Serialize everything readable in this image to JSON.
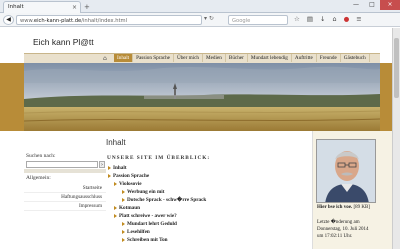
{
  "browser": {
    "tab_title": "Inhalt",
    "tab_close": "×",
    "new_tab": "+",
    "window_buttons": [
      "—",
      "□",
      "×"
    ],
    "url_prefix": "www.",
    "url_host": "eich-kann-platt.de",
    "url_path": "/inhalt/index.html",
    "search_placeholder": "Google",
    "toolbar_icons": [
      "star-icon",
      "clipboard-icon",
      "download-icon",
      "home-icon",
      "adblock-icon",
      "menu-icon"
    ]
  },
  "site": {
    "title": "Eich kann Pl@tt",
    "menu": [
      "Inhalt",
      "Passion Sprache",
      "Über mich",
      "Medien",
      "Bücher",
      "Mundart lebendig",
      "Auftritte",
      "Freunde",
      "Gästebuch"
    ],
    "active_menu": "Inhalt"
  },
  "sidebar": {
    "search_label": "Suchen nach:",
    "search_value": "",
    "section_title": "Allgemein:",
    "links": [
      "Startseite",
      "Haftungsausschluss",
      "Impressum"
    ]
  },
  "content": {
    "heading": "Inhalt",
    "overview": "UNSERE SITE IM ÜBERBLICK:",
    "toc": [
      {
        "level": 1,
        "text": "Inhalt"
      },
      {
        "level": 1,
        "text": "Passion Sprache"
      },
      {
        "level": 2,
        "text": "Violosovie"
      },
      {
        "level": 3,
        "text": "Werbung ein mit"
      },
      {
        "level": 3,
        "text": "Dotsche Sprack - schw�rre Sprack"
      },
      {
        "level": 2,
        "text": "Kotmaun"
      },
      {
        "level": 2,
        "text": "Platt schreiwe - awer wie?"
      },
      {
        "level": 3,
        "text": "Mundart lehrt Geduld"
      },
      {
        "level": 3,
        "text": "Lesehilfen"
      },
      {
        "level": 3,
        "text": "Schreiben mit Ton"
      }
    ]
  },
  "rightcol": {
    "caption": "Hier bse ich voe.",
    "caption_size": "[89 KB]",
    "update_line1": "Letzte �nderung am",
    "update_line2": "Donnerstag, 10. Juli 2014",
    "update_line3": "um 17:02:11 Uhr."
  }
}
